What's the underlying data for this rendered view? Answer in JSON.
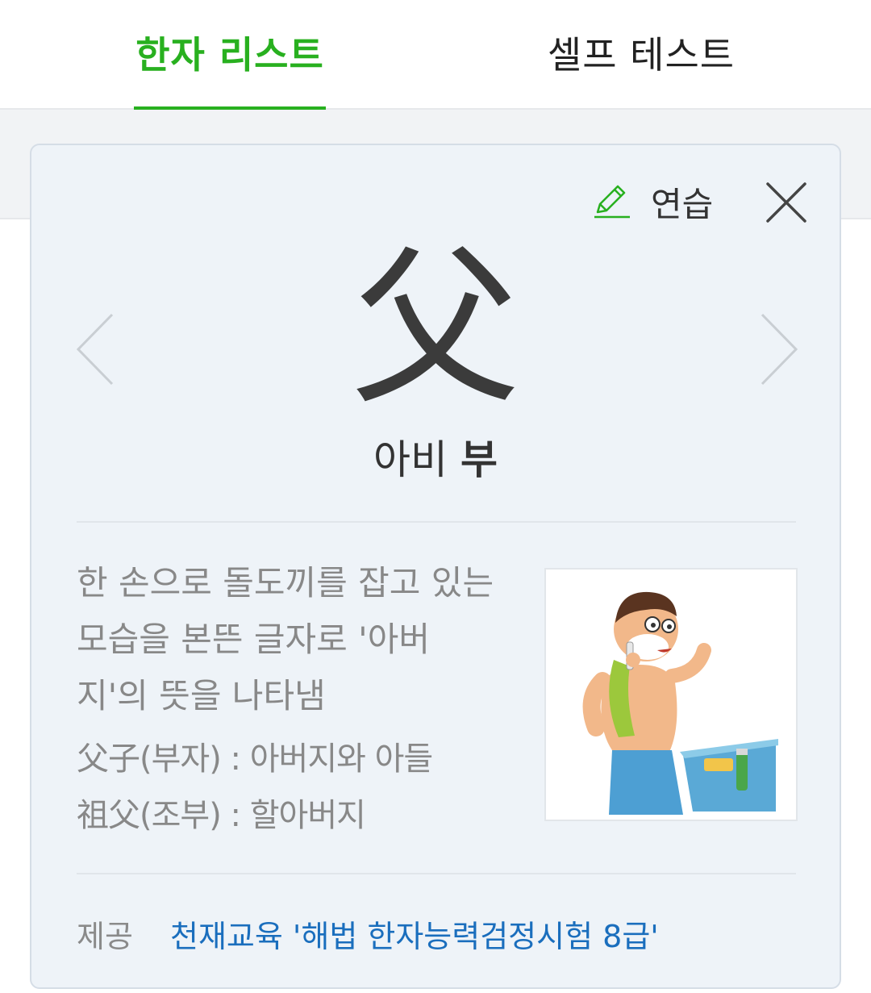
{
  "tabs": [
    {
      "label": "한자 리스트",
      "active": true
    },
    {
      "label": "셀프 테스트",
      "active": false
    }
  ],
  "colors": {
    "accent": "#28b01f",
    "link": "#1a6ebd",
    "card_bg": "#eef3f8"
  },
  "card": {
    "practice_label": "연습",
    "practice_icon": "pencil-icon",
    "close_icon": "close-icon",
    "prev_icon": "chevron-left-icon",
    "next_icon": "chevron-right-icon",
    "hanja": "父",
    "meaning": "아비",
    "sound": "부",
    "description": "한 손으로 돌도끼를 잡고 있는 모습을 본뜬 글자로 '아버지'의 뜻을 나타냄",
    "examples": [
      "父子(부자) : 아버지와 아들",
      "祖父(조부) : 할아버지"
    ],
    "credit_label": "제공",
    "credit_source": "천재교육 '해법 한자능력검정시험 8급'"
  }
}
